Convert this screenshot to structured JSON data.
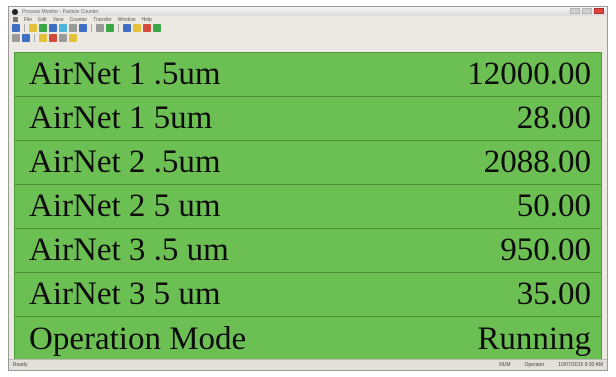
{
  "window": {
    "title": "Process Monitor - Particle Counter"
  },
  "menubar": {
    "items": [
      "File",
      "Edit",
      "View",
      "Counter",
      "Transfer",
      "Window",
      "Help"
    ]
  },
  "toolbar": {
    "row1_icons": [
      "run-icon",
      "open-icon",
      "chart-icon",
      "table-icon",
      "report-icon",
      "filter-icon",
      "print-icon",
      "settings-icon",
      "graph-icon",
      "alarm-icon",
      "stop-icon",
      "go-icon"
    ],
    "row2_icons": [
      "node-icon",
      "globe-icon",
      "star-icon",
      "flag-icon",
      "alert-icon",
      "info-icon"
    ]
  },
  "readings": [
    {
      "label": "AirNet 1 .5um",
      "value": "12000.00"
    },
    {
      "label": "AirNet 1 5um",
      "value": "28.00"
    },
    {
      "label": "AirNet 2 .5um",
      "value": "2088.00"
    },
    {
      "label": "AirNet 2 5 um",
      "value": "50.00"
    },
    {
      "label": "AirNet 3 .5 um",
      "value": "950.00"
    },
    {
      "label": "AirNet 3 5 um",
      "value": "35.00"
    },
    {
      "label": "Operation Mode",
      "value": "Running"
    }
  ],
  "statusbar": {
    "left": "Ready",
    "mode": "NUM",
    "user": "Operator",
    "date": "10/07/2015 9:30 AM"
  },
  "colors": {
    "panel": "#6cbf52",
    "text": "#0c0c0c"
  }
}
